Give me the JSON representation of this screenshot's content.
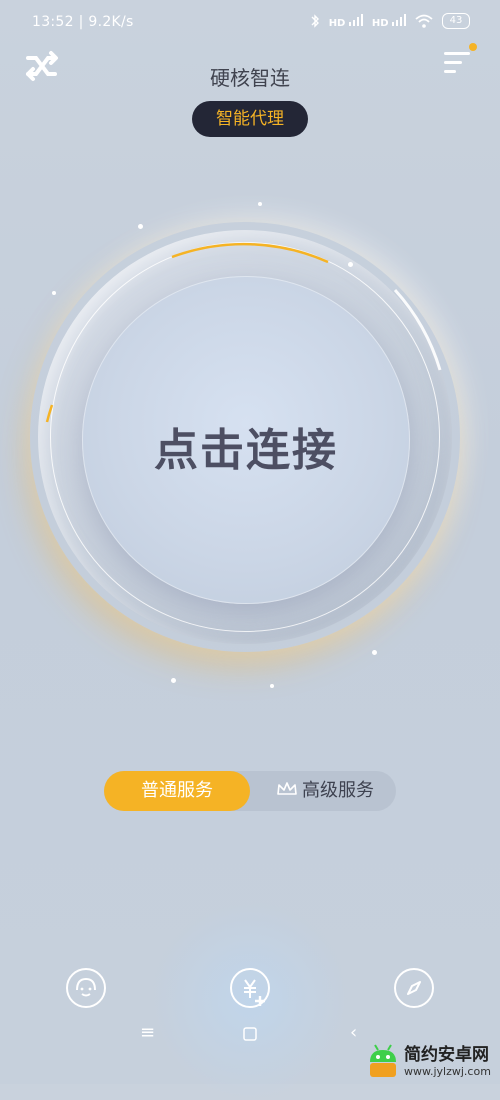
{
  "status_bar": {
    "time_speed": "13:52 | 9.2K/s",
    "signal1": "HD",
    "signal2": "HD",
    "battery": "43"
  },
  "header": {
    "title": "硬核智连",
    "mode_badge": "智能代理",
    "left_icon": "switch-shuffle-icon",
    "right_icon": "menu-icon"
  },
  "main": {
    "connect_label": "点击连接"
  },
  "service_tabs": {
    "basic": "普通服务",
    "premium": "高级服务",
    "selected": "basic"
  },
  "bottom_actions": [
    {
      "icon": "support-icon"
    },
    {
      "icon": "recharge-icon"
    },
    {
      "icon": "compass-icon"
    }
  ],
  "watermark": {
    "name": "简约安卓网",
    "url": "www.jylzwj.com"
  },
  "colors": {
    "accent": "#f5b325",
    "pill_bg": "#232636",
    "background": "#c6d0dc"
  }
}
